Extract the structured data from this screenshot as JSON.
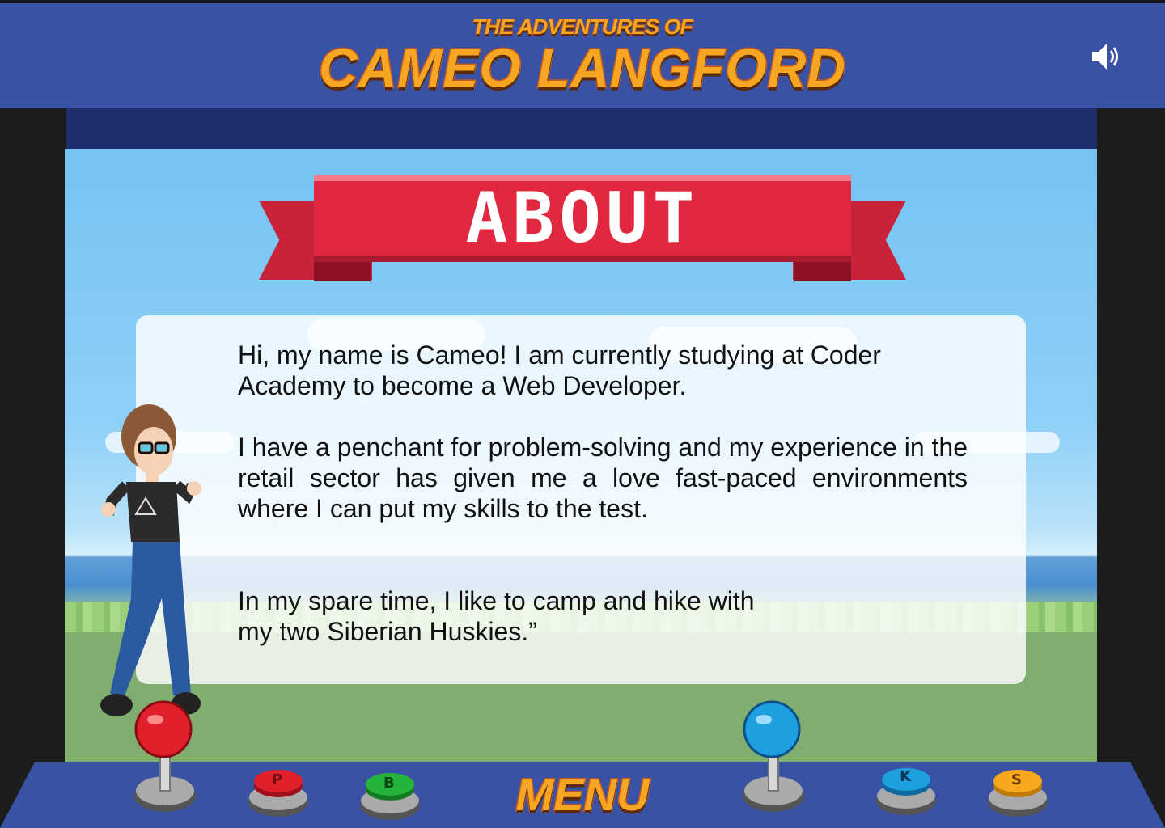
{
  "header": {
    "title_small": "THE ADVENTURES OF",
    "title_big": "CAMEO LANGFORD",
    "sound_icon": "speaker-volume-icon"
  },
  "banner": {
    "label": "ABOUT"
  },
  "about": {
    "paragraph1": "Hi, my name is Cameo! I am currently studying at Coder Academy to become a Web Developer.",
    "paragraph2": "I have a penchant for problem-solving and my experience in the retail sector has given me a love fast-paced environments where I can put my skills to the test.",
    "paragraph3": "In my spare time, I like to camp and hike with my two Siberian Huskies.”"
  },
  "controls": {
    "menu_label": "MENU",
    "buttons": [
      {
        "label": "P",
        "color": "#e0202a"
      },
      {
        "label": "B",
        "color": "#26b33a"
      },
      {
        "label": "K",
        "color": "#1ea0e0"
      },
      {
        "label": "S",
        "color": "#f7a81c"
      }
    ],
    "joystick_left_color": "#e0202a",
    "joystick_right_color": "#1ea0e0"
  },
  "colors": {
    "header_blue": "#3a52a3",
    "banner_red": "#e2283f",
    "title_orange": "#f6a623"
  }
}
